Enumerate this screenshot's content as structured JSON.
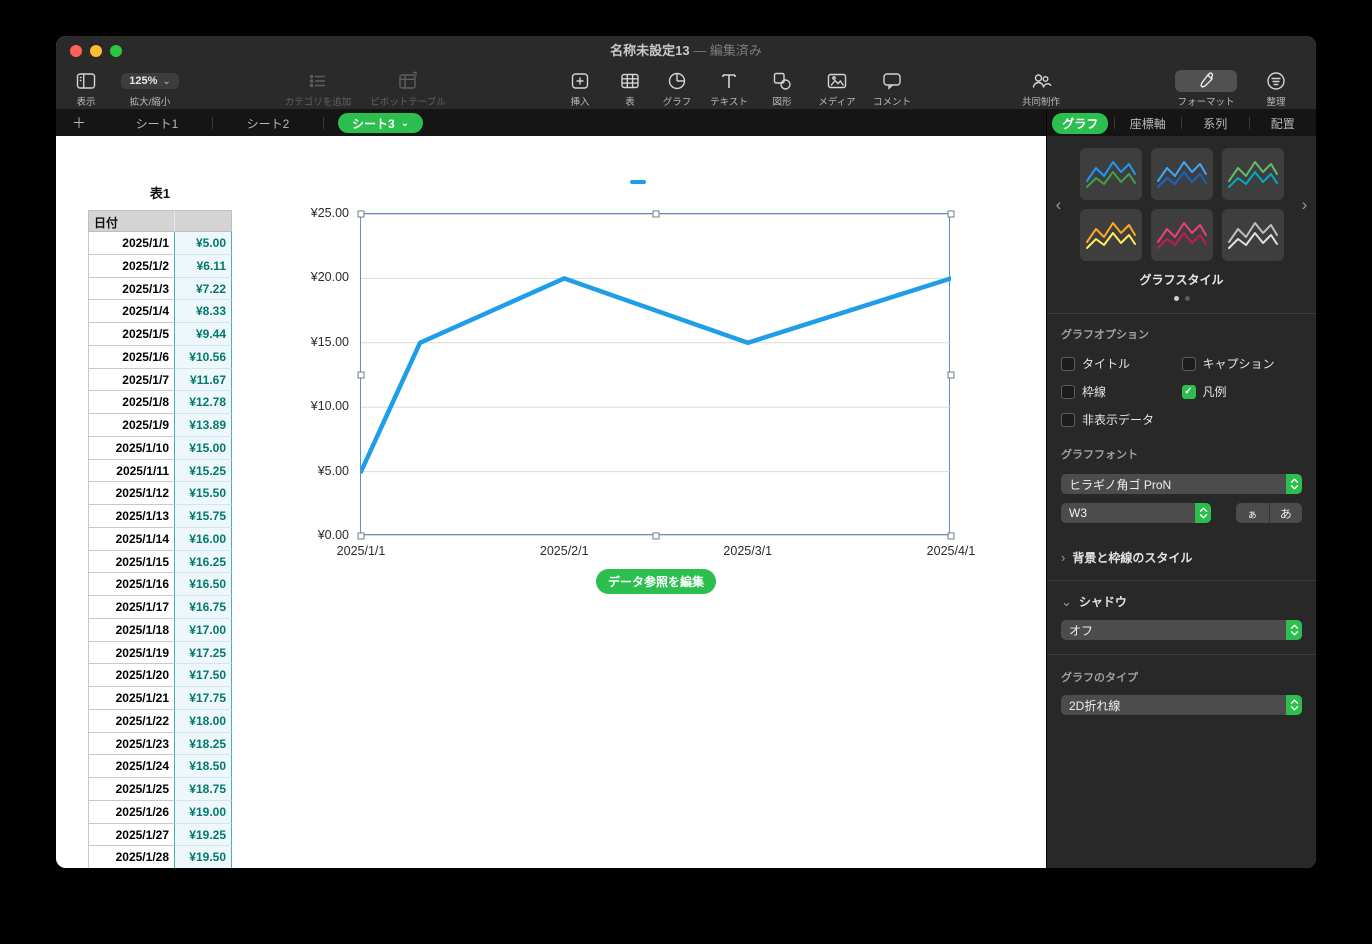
{
  "colors": {
    "accent_green": "#2cbe4e",
    "chart_blue": "#1e9ee8",
    "selection_blue": "#5d8fd0",
    "value_text": "#00796b",
    "value_bg": "#eef7fc",
    "value_border": "#49aebc"
  },
  "icons": {
    "chevron_down": "⌄",
    "chevron_right": "›",
    "chevron_left": "‹",
    "check": "✓",
    "plus": "＋"
  },
  "window": {
    "title": "名称未設定13",
    "suffix": "— 編集済み"
  },
  "toolbar": {
    "view": "表示",
    "zoom_label": "拡大/縮小",
    "zoom_value": "125%",
    "add_category": "カテゴリを追加",
    "pivot": "ピボットテーブル",
    "insert": "挿入",
    "table": "表",
    "chart": "グラフ",
    "text": "テキスト",
    "shape": "図形",
    "media": "メディア",
    "comment": "コメント",
    "collaborate": "共同制作",
    "format": "フォーマット",
    "organize": "整理"
  },
  "sheets": {
    "tabs": [
      "シート1",
      "シート2",
      "シート3"
    ],
    "active": "シート3"
  },
  "sidebar": {
    "tabs": [
      "グラフ",
      "座標軸",
      "系列",
      "配置"
    ],
    "style_label": "グラフスタイル",
    "style_pages": 2,
    "style_active_page": 0,
    "styles": [
      {
        "colors": [
          "#2196f3",
          "#43a047"
        ]
      },
      {
        "colors": [
          "#42a5f5",
          "#1565c0"
        ]
      },
      {
        "colors": [
          "#66bb6a",
          "#00acc1"
        ]
      },
      {
        "colors": [
          "#ffa726",
          "#ffee58"
        ]
      },
      {
        "colors": [
          "#ec407a",
          "#c2185b"
        ]
      },
      {
        "colors": [
          "#bdbdbd",
          "#e0e0e0"
        ]
      }
    ],
    "options_label": "グラフオプション",
    "checkboxes": [
      {
        "label": "タイトル",
        "checked": false
      },
      {
        "label": "キャプション",
        "checked": false
      },
      {
        "label": "枠線",
        "checked": false
      },
      {
        "label": "凡例",
        "checked": true
      },
      {
        "label": "非表示データ",
        "checked": false
      }
    ],
    "font_label": "グラフフォント",
    "font_family": "ヒラギノ角ゴ ProN",
    "font_weight": "W3",
    "font_smaller": "ぁ",
    "font_larger": "あ",
    "bg_border_label": "背景と枠線のスタイル",
    "shadow_label": "シャドウ",
    "shadow_value": "オフ",
    "chart_type_label": "グラフのタイプ",
    "chart_type_value": "2D折れ線"
  },
  "canvas": {
    "table_title": "表1",
    "table": {
      "headers": [
        "日付",
        ""
      ],
      "rows": [
        [
          "2025/1/1",
          "¥5.00"
        ],
        [
          "2025/1/2",
          "¥6.11"
        ],
        [
          "2025/1/3",
          "¥7.22"
        ],
        [
          "2025/1/4",
          "¥8.33"
        ],
        [
          "2025/1/5",
          "¥9.44"
        ],
        [
          "2025/1/6",
          "¥10.56"
        ],
        [
          "2025/1/7",
          "¥11.67"
        ],
        [
          "2025/1/8",
          "¥12.78"
        ],
        [
          "2025/1/9",
          "¥13.89"
        ],
        [
          "2025/1/10",
          "¥15.00"
        ],
        [
          "2025/1/11",
          "¥15.25"
        ],
        [
          "2025/1/12",
          "¥15.50"
        ],
        [
          "2025/1/13",
          "¥15.75"
        ],
        [
          "2025/1/14",
          "¥16.00"
        ],
        [
          "2025/1/15",
          "¥16.25"
        ],
        [
          "2025/1/16",
          "¥16.50"
        ],
        [
          "2025/1/17",
          "¥16.75"
        ],
        [
          "2025/1/18",
          "¥17.00"
        ],
        [
          "2025/1/19",
          "¥17.25"
        ],
        [
          "2025/1/20",
          "¥17.50"
        ],
        [
          "2025/1/21",
          "¥17.75"
        ],
        [
          "2025/1/22",
          "¥18.00"
        ],
        [
          "2025/1/23",
          "¥18.25"
        ],
        [
          "2025/1/24",
          "¥18.50"
        ],
        [
          "2025/1/25",
          "¥18.75"
        ],
        [
          "2025/1/26",
          "¥19.00"
        ],
        [
          "2025/1/27",
          "¥19.25"
        ],
        [
          "2025/1/28",
          "¥19.50"
        ]
      ]
    },
    "edit_data_button": "データ参照を編集"
  },
  "chart_data": {
    "type": "line",
    "title": "",
    "grid": true,
    "legend": "line-swatch-above-chart",
    "ylim": [
      0,
      25
    ],
    "x_span_days": 90,
    "y_ticks": [
      {
        "label": "¥0.00",
        "value": 0
      },
      {
        "label": "¥5.00",
        "value": 5
      },
      {
        "label": "¥10.00",
        "value": 10
      },
      {
        "label": "¥15.00",
        "value": 15
      },
      {
        "label": "¥20.00",
        "value": 20
      },
      {
        "label": "¥25.00",
        "value": 25
      }
    ],
    "x_ticks": [
      {
        "label": "2025/1/1",
        "day": 0
      },
      {
        "label": "2025/2/1",
        "day": 31
      },
      {
        "label": "2025/3/1",
        "day": 59
      },
      {
        "label": "2025/4/1",
        "day": 90
      }
    ],
    "series": [
      {
        "name": "",
        "color": "#1e9ee8",
        "points": [
          {
            "x": "2025/1/1",
            "day": 0,
            "y": 5
          },
          {
            "x": "2025/1/10",
            "day": 9,
            "y": 15
          },
          {
            "x": "2025/2/1",
            "day": 31,
            "y": 20
          },
          {
            "x": "2025/3/1",
            "day": 59,
            "y": 15
          },
          {
            "x": "2025/4/1",
            "day": 90,
            "y": 20
          }
        ]
      }
    ]
  }
}
